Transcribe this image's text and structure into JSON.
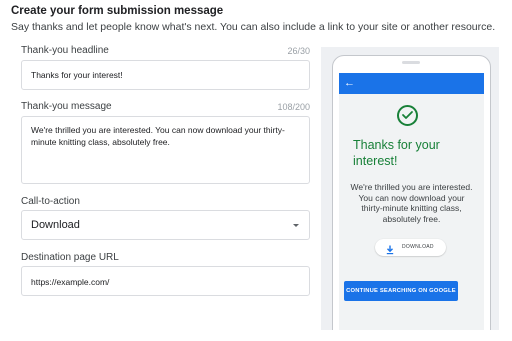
{
  "page": {
    "title": "Create your form submission message",
    "subtitle": "Say thanks and let people know what's next. You can also include a link to your site or another resource."
  },
  "headline_field": {
    "label": "Thank-you headline",
    "count": "26/30",
    "value": "Thanks for your interest!"
  },
  "message_field": {
    "label": "Thank-you message",
    "count": "108/200",
    "value": "We're thrilled you are interested. You can now download your thirty-minute knitting class, absolutely free."
  },
  "cta_field": {
    "label": "Call-to-action",
    "value": "Download"
  },
  "url_field": {
    "label": "Destination page URL",
    "value": "https://example.com/"
  },
  "preview": {
    "back_icon": "arrow-back-icon",
    "check_icon": "check-circle-icon",
    "headline": "Thanks for your interest!",
    "message": "We're thrilled you are interested. You can now download your thirty-minute knitting class, absolutely free.",
    "download_icon": "download-icon",
    "download_label": "DOWNLOAD",
    "continue_label": "CONTINUE SEARCHING ON GOOGLE"
  },
  "colors": {
    "accent": "#1a73e8",
    "success": "#188038",
    "preview_bg": "#eef0f3"
  }
}
